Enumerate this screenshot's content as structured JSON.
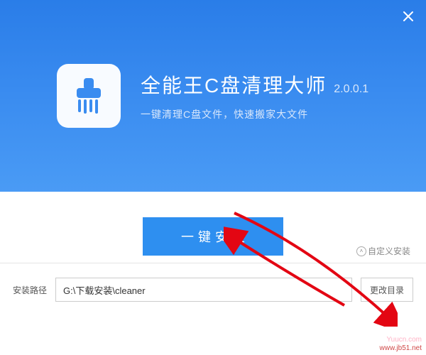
{
  "colors": {
    "hero_bg": "#3a8cf0",
    "button_bg": "#2e8ff0",
    "arrow": "#e30613"
  },
  "hero": {
    "title": "全能王C盘清理大师",
    "version": "2.0.0.1",
    "subtitle": "一键清理C盘文件，快速搬家大文件"
  },
  "install_button": "一键安装",
  "custom_install": "自定义安装",
  "path": {
    "label": "安装路径",
    "value": "G:\\下载安装\\cleaner",
    "change_button": "更改目录"
  },
  "watermark": {
    "line1": "Yuucn.com",
    "line2": "www.jb51.net"
  }
}
